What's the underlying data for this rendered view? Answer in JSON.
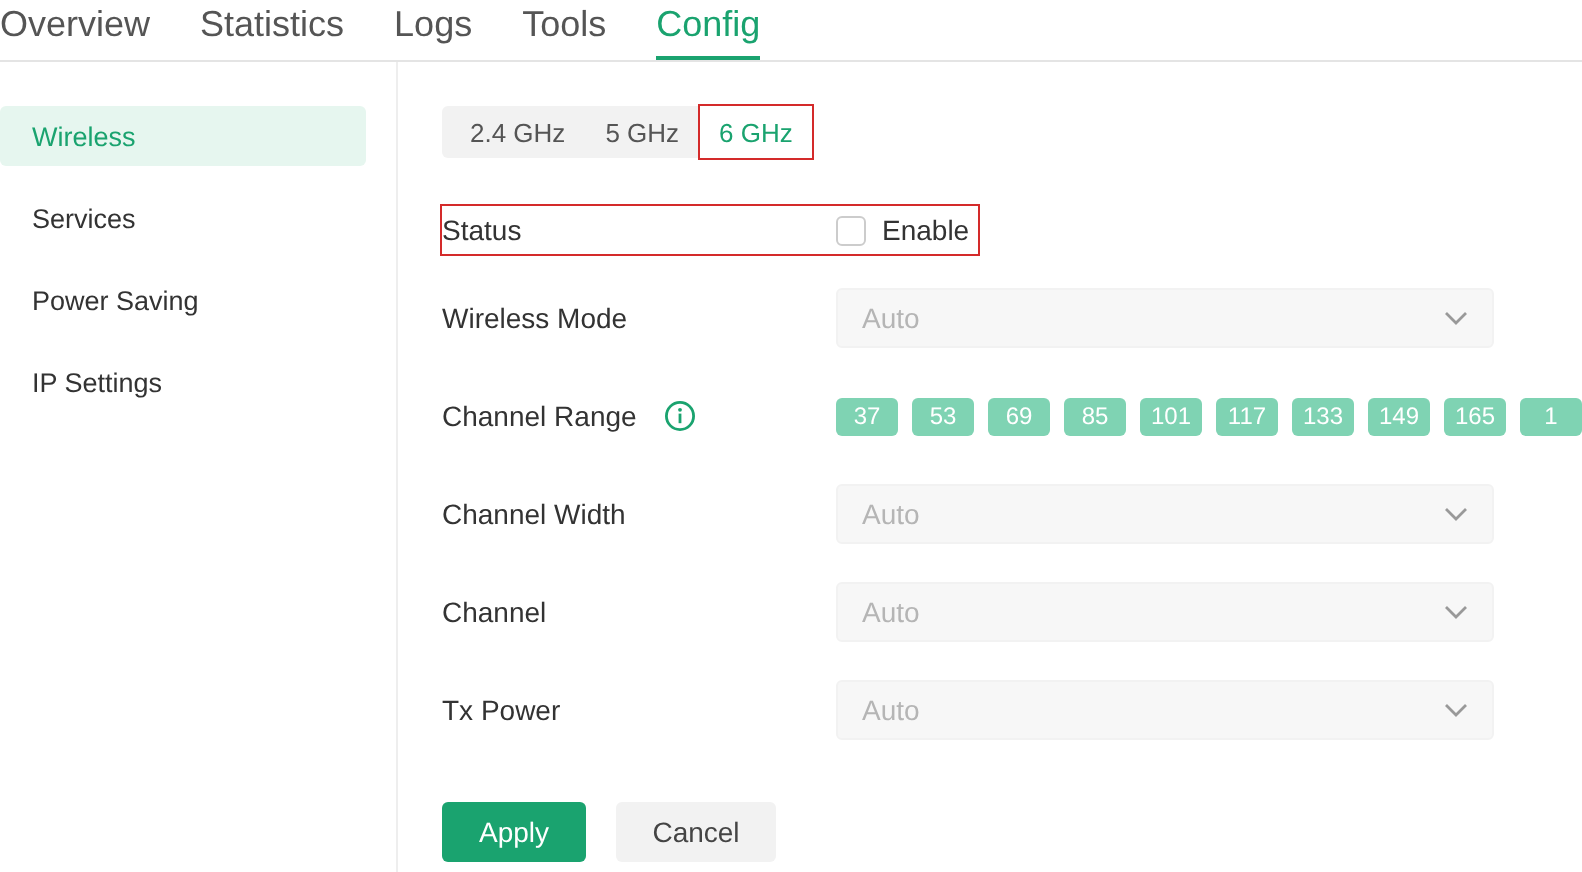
{
  "nav_tabs": [
    {
      "label": "Overview",
      "selected": false
    },
    {
      "label": "Statistics",
      "selected": false
    },
    {
      "label": "Logs",
      "selected": false
    },
    {
      "label": "Tools",
      "selected": false
    },
    {
      "label": "Config",
      "selected": true
    }
  ],
  "sidebar": {
    "items": [
      {
        "label": "Wireless",
        "selected": true
      },
      {
        "label": "Services",
        "selected": false
      },
      {
        "label": "Power Saving",
        "selected": false
      },
      {
        "label": "IP Settings",
        "selected": false
      }
    ]
  },
  "bands": [
    {
      "label": "2.4 GHz",
      "selected": false,
      "highlighted": false
    },
    {
      "label": "5 GHz",
      "selected": false,
      "highlighted": false
    },
    {
      "label": "6 GHz",
      "selected": true,
      "highlighted": true
    }
  ],
  "fields": [
    {
      "kind": "checkbox",
      "label": "Status",
      "option": "Enable",
      "checked": false,
      "highlighted": true
    },
    {
      "kind": "select",
      "label": "Wireless Mode",
      "value": "Auto",
      "disabled": true
    },
    {
      "kind": "chips",
      "label": "Channel Range",
      "info": true,
      "chips": [
        "37",
        "53",
        "69",
        "85",
        "101",
        "117",
        "133",
        "149",
        "165",
        "1"
      ]
    },
    {
      "kind": "select",
      "label": "Channel Width",
      "value": "Auto",
      "disabled": true
    },
    {
      "kind": "select",
      "label": "Channel",
      "value": "Auto",
      "disabled": true
    },
    {
      "kind": "select",
      "label": "Tx Power",
      "value": "Auto",
      "disabled": true
    }
  ],
  "buttons": [
    {
      "label": "Apply",
      "kind": "primary"
    },
    {
      "label": "Cancel",
      "kind": "secondary"
    }
  ]
}
